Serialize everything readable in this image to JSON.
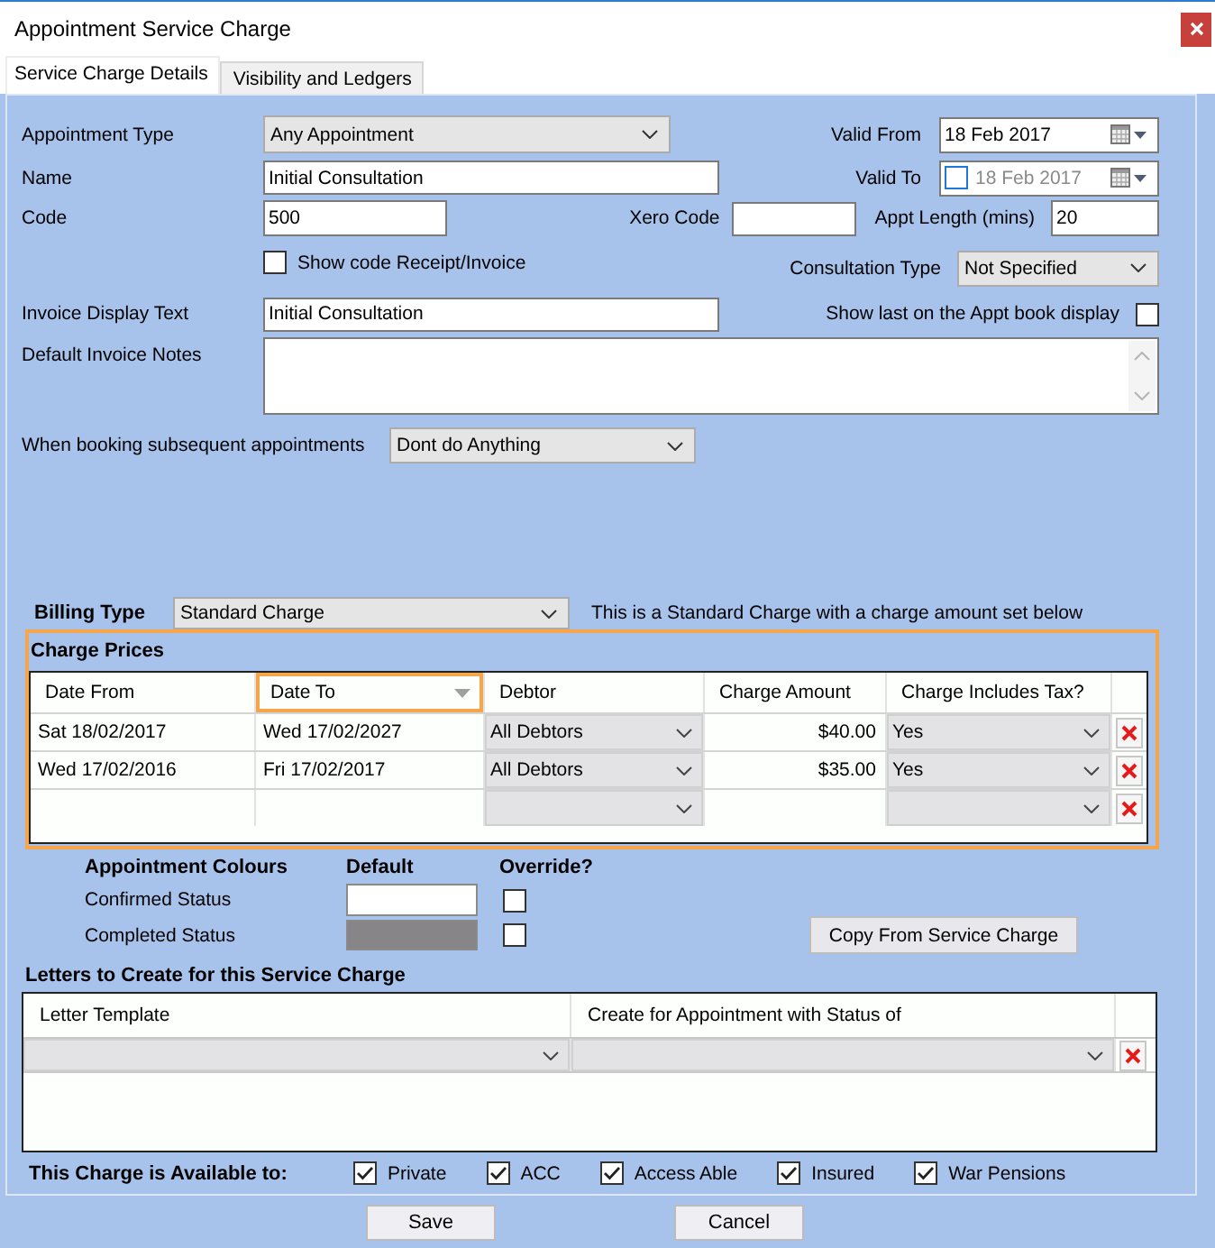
{
  "window": {
    "title": "Appointment Service Charge"
  },
  "tabs": [
    {
      "label": "Service Charge Details",
      "selected": true
    },
    {
      "label": "Visibility and Ledgers",
      "selected": false
    }
  ],
  "details": {
    "appointment_type": {
      "label": "Appointment Type",
      "value": "Any Appointment"
    },
    "valid_from": {
      "label": "Valid From",
      "value": "18 Feb 2017"
    },
    "name": {
      "label": "Name",
      "value": "Initial Consultation"
    },
    "valid_to": {
      "label": "Valid To",
      "value": "18 Feb 2017",
      "checked": false
    },
    "code": {
      "label": "Code",
      "value": "500"
    },
    "xero_code": {
      "label": "Xero Code"
    },
    "appt_length": {
      "label": "Appt Length (mins)",
      "value": "20"
    },
    "show_code": {
      "label": "Show code Receipt/Invoice",
      "checked": false
    },
    "consultation_type": {
      "label": "Consultation Type",
      "value": "Not Specified"
    },
    "invoice_display_text": {
      "label": "Invoice Display Text",
      "value": "Initial Consultation"
    },
    "show_last": {
      "label": "Show last on the Appt book display",
      "checked": false
    },
    "default_invoice_notes": {
      "label": "Default Invoice Notes"
    },
    "subsequent": {
      "label": "When booking subsequent appointments",
      "value": "Dont do Anything"
    }
  },
  "billing": {
    "label": "Billing Type",
    "value": "Standard Charge",
    "note": "This is a Standard Charge with a charge amount set below"
  },
  "charge_prices": {
    "title": "Charge Prices",
    "columns": [
      {
        "label": "Date From",
        "selected": false
      },
      {
        "label": "Date To",
        "selected": true
      },
      {
        "label": "Debtor",
        "selected": false
      },
      {
        "label": "Charge Amount",
        "selected": false
      },
      {
        "label": "Charge Includes Tax?",
        "selected": false
      }
    ],
    "rows": [
      {
        "date_from": "Sat 18/02/2017",
        "date_to": "Wed 17/02/2027",
        "debtor": "All Debtors",
        "amount": "$40.00",
        "includes_tax": "Yes"
      },
      {
        "date_from": "Wed 17/02/2016",
        "date_to": "Fri 17/02/2017",
        "debtor": "All Debtors",
        "amount": "$35.00",
        "includes_tax": "Yes"
      },
      {}
    ]
  },
  "appointment_colours": {
    "title": "Appointment Colours",
    "default_heading": "Default",
    "override_heading": "Override?",
    "statuses": [
      {
        "label": "Confirmed Status",
        "color": "#ffffff",
        "override": false
      },
      {
        "label": "Completed Status",
        "color": "#878587",
        "override": false
      }
    ],
    "copy_button": "Copy From Service Charge"
  },
  "letters": {
    "title": "Letters to Create for this Service Charge",
    "columns": [
      "Letter Template",
      "Create for Appointment with Status of"
    ],
    "rows": [
      {}
    ]
  },
  "availability": {
    "label": "This Charge is Available to:",
    "options": [
      {
        "label": "Private",
        "checked": true
      },
      {
        "label": "ACC",
        "checked": true
      },
      {
        "label": "Access Able",
        "checked": true
      },
      {
        "label": "Insured",
        "checked": true
      },
      {
        "label": "War Pensions",
        "checked": true
      }
    ]
  },
  "buttons": [
    {
      "label": "Save"
    },
    {
      "label": "Cancel"
    }
  ]
}
